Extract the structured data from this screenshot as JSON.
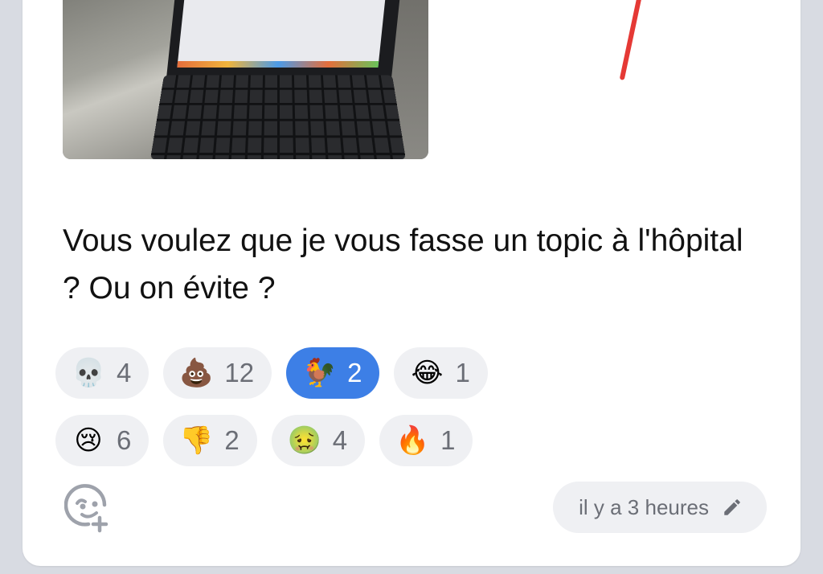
{
  "post": {
    "text": "Vous voulez que je vous fasse un topic à l'hôpital ? Ou on évite ?"
  },
  "reactions": {
    "row1": [
      {
        "icon": "skull-emoji",
        "emoji": "💀",
        "count": "4",
        "active": false
      },
      {
        "icon": "poop-emoji",
        "emoji": "💩",
        "count": "12",
        "active": true,
        "active_state": false
      },
      {
        "icon": "rooster-emoji",
        "emoji": "🐓",
        "count": "2",
        "active": true
      },
      {
        "icon": "crying-laughing-emoji",
        "emoji": "😂",
        "count": "1",
        "active": false
      }
    ],
    "row2": [
      {
        "icon": "sad-tear-emoji",
        "emoji": "😢",
        "count": "6",
        "active": false
      },
      {
        "icon": "thumbs-down-emoji",
        "emoji": "👎",
        "count": "2",
        "active": false
      },
      {
        "icon": "nauseated-face-emoji",
        "emoji": "🤢",
        "count": "4",
        "active": false
      },
      {
        "icon": "fire-emoji",
        "emoji": "🔥",
        "count": "1",
        "active": false
      }
    ]
  },
  "footer": {
    "timestamp": "il y a 3 heures",
    "edit_icon": "pencil-icon",
    "add_reaction_icon": "add-reaction-icon"
  },
  "colors": {
    "active_reaction": "#3d7fe6",
    "chip_background": "#eff0f3",
    "page_background": "#d8dbe2",
    "red_mark": "#e53935"
  }
}
